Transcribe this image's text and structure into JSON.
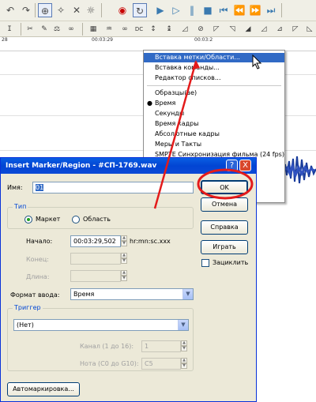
{
  "toolbar": {
    "top_icons": [
      "undo-icon",
      "redo-icon",
      "normalize-icon",
      "magic-wand-icon",
      "cross-icon",
      "gear-icon",
      "record-icon",
      "loop-icon",
      "play-icon",
      "play-region-icon",
      "pause-icon",
      "stop-icon",
      "go-start-icon",
      "rewind-icon",
      "forward-icon",
      "go-end-icon"
    ],
    "second_icons": [
      "cursor-icon",
      "marker-icon",
      "edit-icon",
      "scale-icon",
      "link-icon",
      "cd-icon",
      "dc-label",
      "vol-icon",
      "pan-icon",
      "sel-icon",
      "fx1-icon",
      "fx2-icon",
      "fx3-icon",
      "fx4-icon",
      "fx5-icon",
      "fx6-icon",
      "fx7-icon"
    ],
    "dc_label": "DC"
  },
  "ruler": {
    "ticks": [
      "28",
      "00:03:29",
      "00:03:2"
    ]
  },
  "context_menu": {
    "items": [
      {
        "label": "Вставка метки/Области...",
        "selected": true
      },
      {
        "label": "Вставка команды..."
      },
      {
        "label": "Редактор списков..."
      },
      {
        "label": "Образцы(ве)"
      },
      {
        "label": "Время",
        "bullet": true
      },
      {
        "label": "Секунды"
      },
      {
        "label": "Время кадры"
      },
      {
        "label": "Абсолютные кадры"
      },
      {
        "label": "Меры и Такты"
      },
      {
        "label": "SMPTE Синхронизация фильма (24 fps)"
      }
    ],
    "tail_items": [
      "deo)",
      "deo)"
    ]
  },
  "dialog": {
    "title": "Insert Marker/Region - #СП-1769.wav",
    "help_btn": "?",
    "close_btn": "X",
    "name_label": "Имя:",
    "name_value": "01",
    "ok": "OK",
    "cancel": "Отмена",
    "help": "Справка",
    "play": "Играть",
    "loop": "Зациклить",
    "type_group": "Тип",
    "marker": "Маркет",
    "region": "Область",
    "start_label": "Начало:",
    "start_value": "00:03:29,502",
    "time_format_hint": "hr:mn:sc.xxx",
    "end_label": "Конец:",
    "length_label": "Длина:",
    "input_format_label": "Формат ввода:",
    "input_format_value": "Время",
    "trigger_group": "Триггер",
    "trigger_value": "(Нет)",
    "channel_label": "Канал (1 до 16):",
    "channel_value": "1",
    "note_label": "Нота (C0 до G10):",
    "note_value": "C5",
    "auto_btn": "Автомаркировка..."
  },
  "annotation_colors": {
    "highlight": "#e31b1b",
    "accent": "#316ac5"
  }
}
